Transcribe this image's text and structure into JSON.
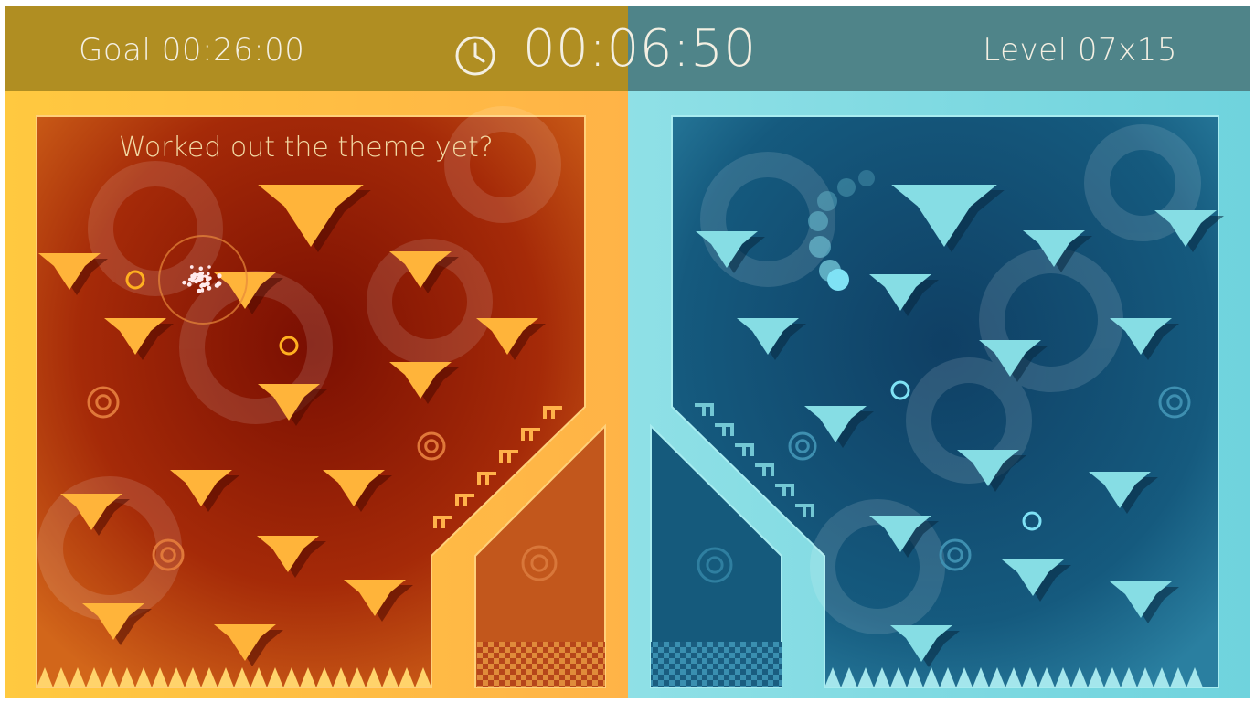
{
  "hud": {
    "goal_label": "Goal 00:26:00",
    "timer_value": "00:06:50",
    "level_label": "Level 07x15"
  },
  "hint_text": "Worked out the theme yet?",
  "colors": {
    "warm_frame": "#ffbe3c",
    "warm_field": "#8e1a06",
    "warm_hud": "#b08e22",
    "cool_frame": "#7fd9e0",
    "cool_field": "#124a6e",
    "cool_hud": "#4f8489",
    "warm_platform": "#ffb43a",
    "cool_platform": "#86dde4"
  },
  "icons": [
    "clock-icon",
    "ball-icon",
    "ring-icon",
    "chevron-arrow-icon",
    "spike-icon",
    "checkered-goal-icon"
  ]
}
